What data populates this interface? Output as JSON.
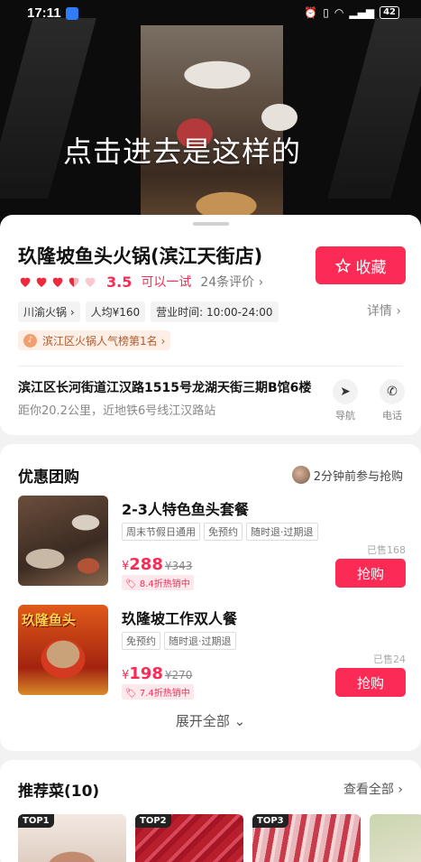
{
  "status_bar": {
    "time": "17:11",
    "battery": "42"
  },
  "hero": {
    "caption": "点击进去是这样的"
  },
  "shop": {
    "name": "玖隆坡鱼头火锅(滨江天街店)",
    "favorite_label": "收藏",
    "rating_hearts": 5,
    "score": "3.5",
    "level": "可以一试",
    "reviews": "24条评价 ›",
    "tags": [
      "川渝火锅 ›",
      "人均¥160",
      "营业时间: 10:00-24:00"
    ],
    "details_label": "详情 ›",
    "rank_label": "滨江区火锅人气榜第1名 ›",
    "address": "滨江区长河街道江汉路1515号龙湖天街三期B馆6楼",
    "distance": "距你20.2公里，近地铁6号线江汉路站",
    "nav_label": "导航",
    "call_label": "电话"
  },
  "deals": {
    "title": "优惠团购",
    "joined": "2分钟前参与抢购",
    "items": [
      {
        "title": "2-3人特色鱼头套餐",
        "chips": [
          "周末节假日通用",
          "免预约",
          "随时退·过期退"
        ],
        "currency": "¥",
        "price": "288",
        "original": "¥343",
        "discount": "8.4折热销中",
        "sold": "已售168",
        "buy_label": "抢购"
      },
      {
        "title": "玖隆坡工作双人餐",
        "chips": [
          "免预约",
          "随时退·过期退"
        ],
        "currency": "¥",
        "price": "198",
        "original": "¥270",
        "discount": "7.4折热销中",
        "sold": "已售24",
        "buy_label": "抢购"
      }
    ],
    "expand_label": "展开全部 ⌄"
  },
  "recommend": {
    "title": "推荐菜(10)",
    "see_all": "查看全部 ›",
    "dishes": [
      {
        "badge": "TOP1"
      },
      {
        "badge": "TOP2"
      },
      {
        "badge": "TOP3"
      }
    ]
  },
  "colors": {
    "accent": "#fc2b55"
  }
}
